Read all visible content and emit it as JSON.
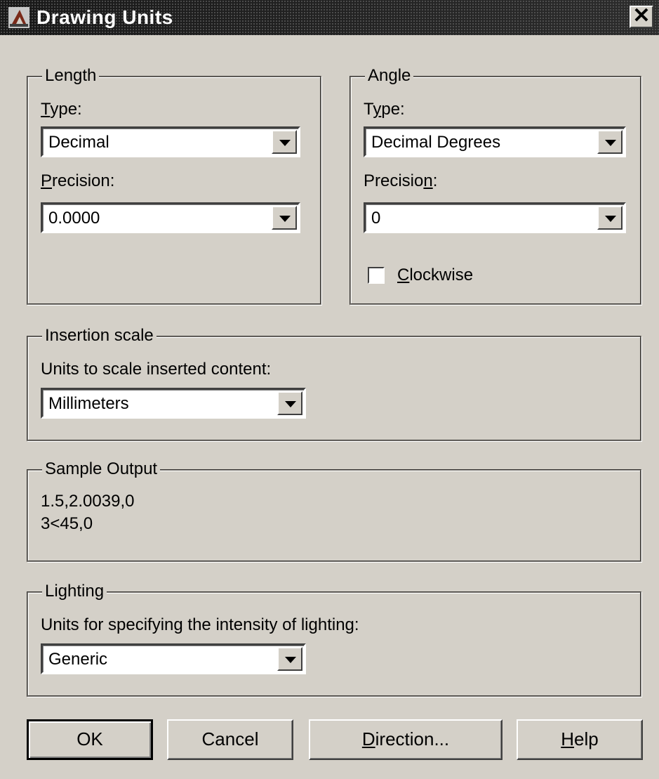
{
  "title": "Drawing Units",
  "icons": {
    "app": "autocad-app-icon",
    "close": "close-icon",
    "dropdown": "chevron-down-icon"
  },
  "length": {
    "group_label": "Length",
    "type_label": "Type:",
    "type_value": "Decimal",
    "precision_label": "Precision:",
    "precision_value": "0.0000"
  },
  "angle": {
    "group_label": "Angle",
    "type_label": "Type:",
    "type_value": "Decimal Degrees",
    "precision_label": "Precision:",
    "precision_value": "0",
    "clockwise_label": "Clockwise",
    "clockwise_checked": false
  },
  "insertion": {
    "group_label": "Insertion scale",
    "units_label": "Units to scale inserted content:",
    "units_value": "Millimeters"
  },
  "sample": {
    "group_label": "Sample Output",
    "line1": "1.5,2.0039,0",
    "line2": "3<45,0"
  },
  "lighting": {
    "group_label": "Lighting",
    "units_label": "Units for specifying the intensity of lighting:",
    "units_value": "Generic"
  },
  "buttons": {
    "ok": "OK",
    "cancel": "Cancel",
    "direction": "Direction...",
    "help": "Help"
  }
}
